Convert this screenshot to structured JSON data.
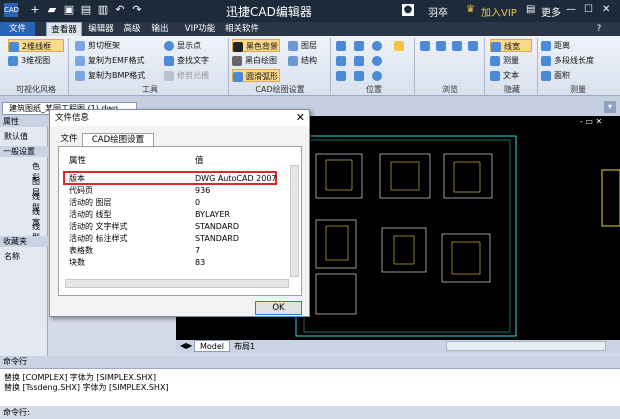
{
  "app": {
    "title": "迅捷CAD编辑器",
    "user": "羽卒",
    "vip": "加入VIP",
    "more": "更多"
  },
  "menu": [
    "文件",
    "查看器",
    "编辑器",
    "高级",
    "输出",
    "VIP功能",
    "相关软件"
  ],
  "ribbon": {
    "view_mode": [
      "2维线框",
      "3维视图"
    ],
    "view_mode_label": "可视化风格",
    "tools": [
      "剪切框架",
      "复制为EMF格式",
      "复制为BMP格式",
      "显示点",
      "查找文字",
      "修剪光栅"
    ],
    "tools_label": "工具",
    "cad_settings": [
      "黑色背景",
      "黑白绘图",
      "圆滑弧形",
      "图层",
      "结构"
    ],
    "cad_settings_label": "CAD绘图设置",
    "position_label": "位置",
    "browse_label": "浏览",
    "hide": [
      "线宽",
      "测量",
      "文本"
    ],
    "hide_label": "隐藏",
    "measure": [
      "距离",
      "多段线长度",
      "面积"
    ],
    "measure_label": "测量"
  },
  "doc_tab": "建筑图纸_某园工程图 (1).dwg",
  "left_panel": {
    "header": "属性",
    "default": "默认值",
    "general": "一般设置",
    "rows": [
      "色彩",
      "图层",
      "线型",
      "线宽",
      "线型"
    ],
    "favorites": "收藏夹",
    "name": "名称"
  },
  "canvas": {
    "tabs": [
      "Model",
      "布局1"
    ]
  },
  "command": {
    "header": "命令行",
    "lines": [
      "替换 [COMPLEX] 字体为 [SIMPLEX.SHX]",
      "替换 [Tssdeng.SHX] 字体为 [SIMPLEX.SHX]"
    ],
    "prompt": "命令行:"
  },
  "dialog": {
    "title": "文件信息",
    "tabs": [
      "文件",
      "CAD绘图设置"
    ],
    "col_property": "属性",
    "col_value": "值",
    "rows": [
      {
        "k": "版本",
        "v": "DWG AutoCAD 2007"
      },
      {
        "k": "代码页",
        "v": "936"
      },
      {
        "k": "活动的 图层",
        "v": "0"
      },
      {
        "k": "活动的 线型",
        "v": "BYLAYER"
      },
      {
        "k": "活动的 文字样式",
        "v": "STANDARD"
      },
      {
        "k": "活动的 标注样式",
        "v": "STANDARD"
      },
      {
        "k": "表格数",
        "v": "7"
      },
      {
        "k": "块数",
        "v": "83"
      }
    ],
    "ok": "OK"
  },
  "colors": {
    "titlebar": "#1d2a3a",
    "accent": "#2b63b3",
    "highlight": "#d62b2b",
    "canvas": "#000000"
  }
}
